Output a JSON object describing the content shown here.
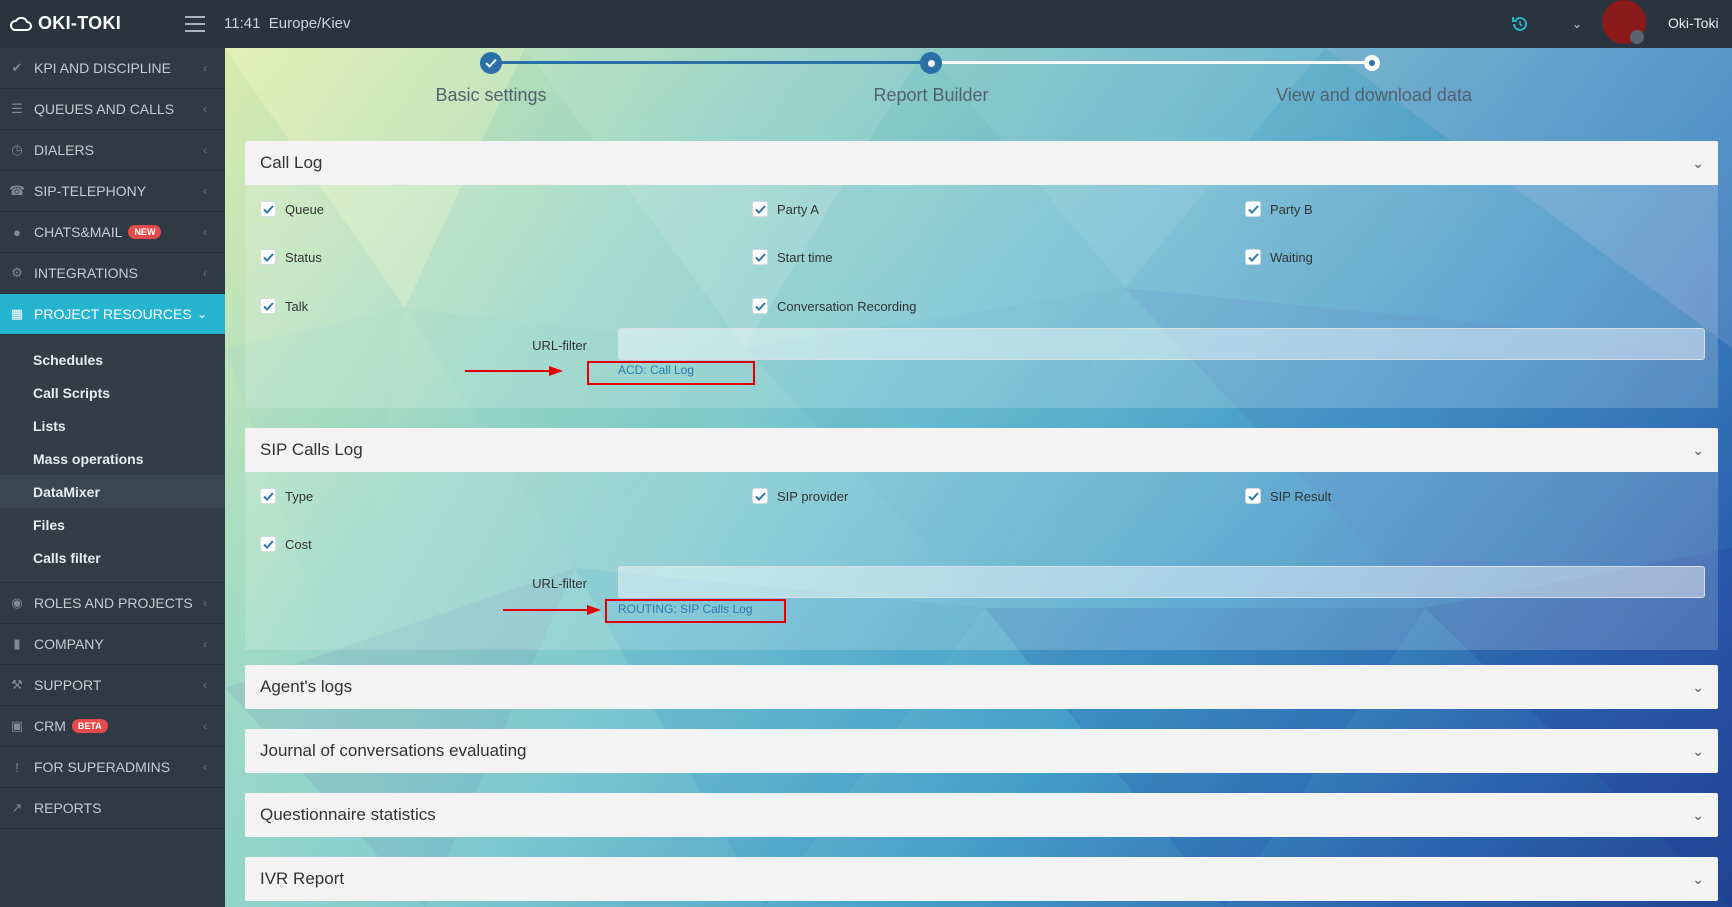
{
  "app": {
    "name": "OKI-TOKI",
    "time": "11:41",
    "timezone": "Europe/Kiev",
    "user": "Oki-Toki"
  },
  "sidebar": {
    "items": [
      {
        "label": "KPI AND DISCIPLINE",
        "icon": "check-icon"
      },
      {
        "label": "QUEUES AND CALLS",
        "icon": "list-icon"
      },
      {
        "label": "DIALERS",
        "icon": "clock-icon"
      },
      {
        "label": "SIP-TELEPHONY",
        "icon": "phone-icon"
      },
      {
        "label": "CHATS&MAIL",
        "icon": "chat-icon",
        "badge": "NEW"
      },
      {
        "label": "INTEGRATIONS",
        "icon": "gears-icon"
      },
      {
        "label": "PROJECT RESOURCES",
        "icon": "grid-icon",
        "active": true
      },
      {
        "label": "ROLES AND PROJECTS",
        "icon": "toggle-icon"
      },
      {
        "label": "COMPANY",
        "icon": "bar-chart-icon"
      },
      {
        "label": "SUPPORT",
        "icon": "wrench-icon"
      },
      {
        "label": "CRM",
        "icon": "card-icon",
        "badge": "BETA"
      },
      {
        "label": "FOR SUPERADMINS",
        "icon": "exclamation-icon"
      },
      {
        "label": "REPORTS",
        "icon": "line-chart-icon"
      }
    ],
    "submenu": [
      "Schedules",
      "Call Scripts",
      "Lists",
      "Mass operations",
      "DataMixer",
      "Files",
      "Calls filter"
    ],
    "submenu_current": "DataMixer"
  },
  "stepper": {
    "steps": [
      "Basic settings",
      "Report Builder",
      "View and download data"
    ]
  },
  "panels": {
    "call_log": {
      "title": "Call Log",
      "checks": [
        "Queue",
        "Party A",
        "Party B",
        "Status",
        "Start time",
        "Waiting",
        "Talk",
        "Conversation Recording"
      ],
      "url_label": "URL-filter",
      "url_value": "",
      "link": "ACD: Call Log"
    },
    "sip_calls_log": {
      "title": "SIP Calls Log",
      "checks": [
        "Type",
        "SIP provider",
        "SIP Result",
        "Cost"
      ],
      "url_label": "URL-filter",
      "url_value": "",
      "link": "ROUTING: SIP Calls Log"
    },
    "agents_logs": {
      "title": "Agent's logs"
    },
    "journal": {
      "title": "Journal of conversations evaluating"
    },
    "questionnaire": {
      "title": "Questionnaire statistics"
    },
    "ivr": {
      "title": "IVR Report"
    }
  },
  "colors": {
    "accent": "#26b4cf",
    "step_blue": "#2a6fa6",
    "annotation_red": "#e00000",
    "badge_red": "#e64a4a"
  }
}
